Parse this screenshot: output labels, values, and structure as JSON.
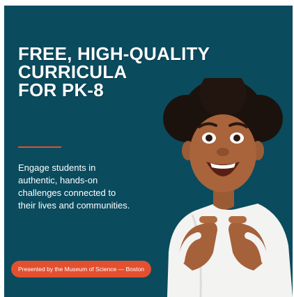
{
  "headline": {
    "lines": [
      "FREE, HIGH-QUALITY",
      "CURRICULA",
      "FOR PK-8"
    ]
  },
  "body_text": "Engage students in authentic, hands-on challenges connected to their lives and communities.",
  "badge": {
    "label": "Presented by the Museum of Science — Boston"
  },
  "photo": {
    "icon": "child-photo"
  },
  "colors": {
    "background": "#0a4b5e",
    "accent": "#e3502f",
    "text": "#ffffff"
  }
}
